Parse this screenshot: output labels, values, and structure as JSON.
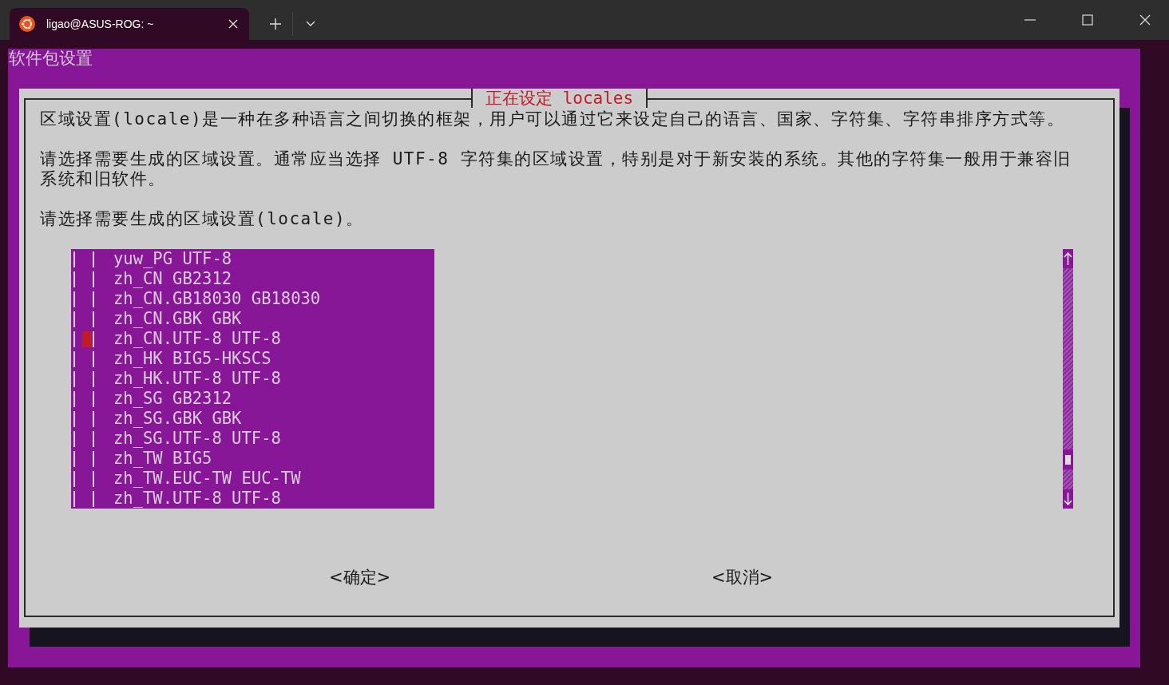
{
  "tab": {
    "title": "ligao@ASUS-ROG: ~"
  },
  "terminal": {
    "backtitle": "软件包设置",
    "dialog": {
      "title": "正在设定 locales",
      "paragraphs": [
        "区域设置(locale)是一种在多种语言之间切换的框架，用户可以通过它来设定自己的语言、国家、字符集、字符串排序方式等。",
        "请选择需要生成的区域设置。通常应当选择 UTF-8 字符集的区域设置，特别是对于新安装的系统。其他的字符集一般用于兼容旧系统和旧软件。",
        "请选择需要生成的区域设置(locale)。"
      ],
      "items": [
        {
          "label": "yuw_PG UTF-8",
          "checked": false,
          "selected": false
        },
        {
          "label": "zh_CN GB2312",
          "checked": false,
          "selected": false
        },
        {
          "label": "zh_CN.GB18030 GB18030",
          "checked": false,
          "selected": false
        },
        {
          "label": "zh_CN.GBK GBK",
          "checked": false,
          "selected": false
        },
        {
          "label": "zh_CN.UTF-8 UTF-8",
          "checked": false,
          "selected": true
        },
        {
          "label": "zh_HK BIG5-HKSCS",
          "checked": false,
          "selected": false
        },
        {
          "label": "zh_HK.UTF-8 UTF-8",
          "checked": false,
          "selected": false
        },
        {
          "label": "zh_SG GB2312",
          "checked": false,
          "selected": false
        },
        {
          "label": "zh_SG.GBK GBK",
          "checked": false,
          "selected": false
        },
        {
          "label": "zh_SG.UTF-8 UTF-8",
          "checked": false,
          "selected": false
        },
        {
          "label": "zh_TW BIG5",
          "checked": false,
          "selected": false
        },
        {
          "label": "zh_TW.EUC-TW EUC-TW",
          "checked": false,
          "selected": false
        },
        {
          "label": "zh_TW.UTF-8 UTF-8",
          "checked": false,
          "selected": false
        }
      ],
      "buttons": [
        "<确定>",
        "<取消>"
      ]
    }
  }
}
